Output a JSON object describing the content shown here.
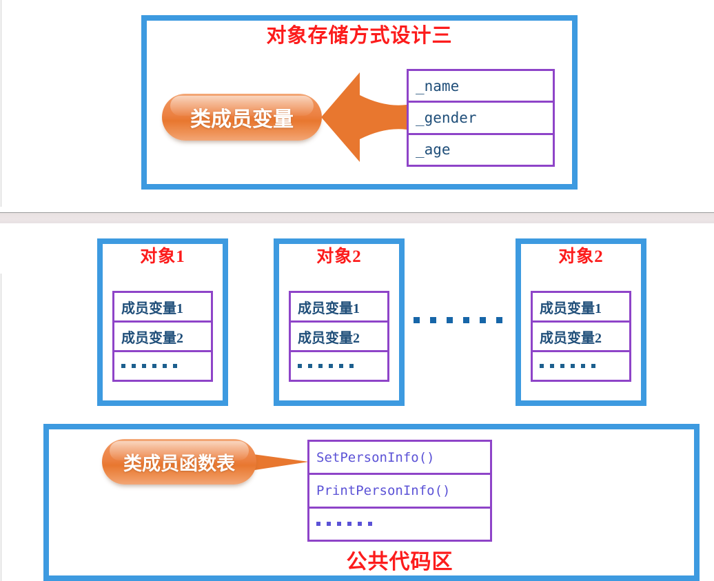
{
  "palette": {
    "frame_blue": "#3d9ae0",
    "title_red": "#fc1c1c",
    "table_purple": "#8e44c8",
    "callout_orange": "#e8772f",
    "code_navy": "#1f4e79",
    "code_violet": "#5b52d6",
    "band_gray": "#e9e2e2"
  },
  "top_panel": {
    "title": "对象存储方式设计三",
    "callout": {
      "label": "类成员变量",
      "icon": "orange-pill-callout"
    },
    "arrow": {
      "icon": "left-arrow-icon",
      "direction": "left"
    },
    "member_table": {
      "rows": [
        {
          "text": "_name"
        },
        {
          "text": "_gender"
        },
        {
          "text": "_age"
        }
      ]
    }
  },
  "bottom_panel": {
    "objects": [
      {
        "title": "对象1",
        "rows": [
          {
            "type": "text",
            "text": "成员变量1"
          },
          {
            "type": "text",
            "text": "成员变量2"
          },
          {
            "type": "dots",
            "text": "……",
            "count": 6
          }
        ]
      },
      {
        "title": "对象2",
        "rows": [
          {
            "type": "text",
            "text": "成员变量1"
          },
          {
            "type": "text",
            "text": "成员变量2"
          },
          {
            "type": "dots",
            "text": "……",
            "count": 6
          }
        ]
      },
      {
        "title": "对象2",
        "rows": [
          {
            "type": "text",
            "text": "成员变量1"
          },
          {
            "type": "text",
            "text": "成员变量2"
          },
          {
            "type": "dots",
            "text": "……",
            "count": 6
          }
        ]
      }
    ],
    "objects_ellipsis": {
      "text": "……",
      "count": 6
    },
    "code_area": {
      "footer_title": "公共代码区",
      "callout": {
        "label": "类成员函数表",
        "icon": "orange-pill-callout-with-tail"
      },
      "function_table": {
        "rows": [
          {
            "type": "text",
            "text": "SetPersonInfo()"
          },
          {
            "type": "text",
            "text": "PrintPersonInfo()"
          },
          {
            "type": "dots",
            "text": "……",
            "count": 6
          }
        ]
      }
    }
  }
}
